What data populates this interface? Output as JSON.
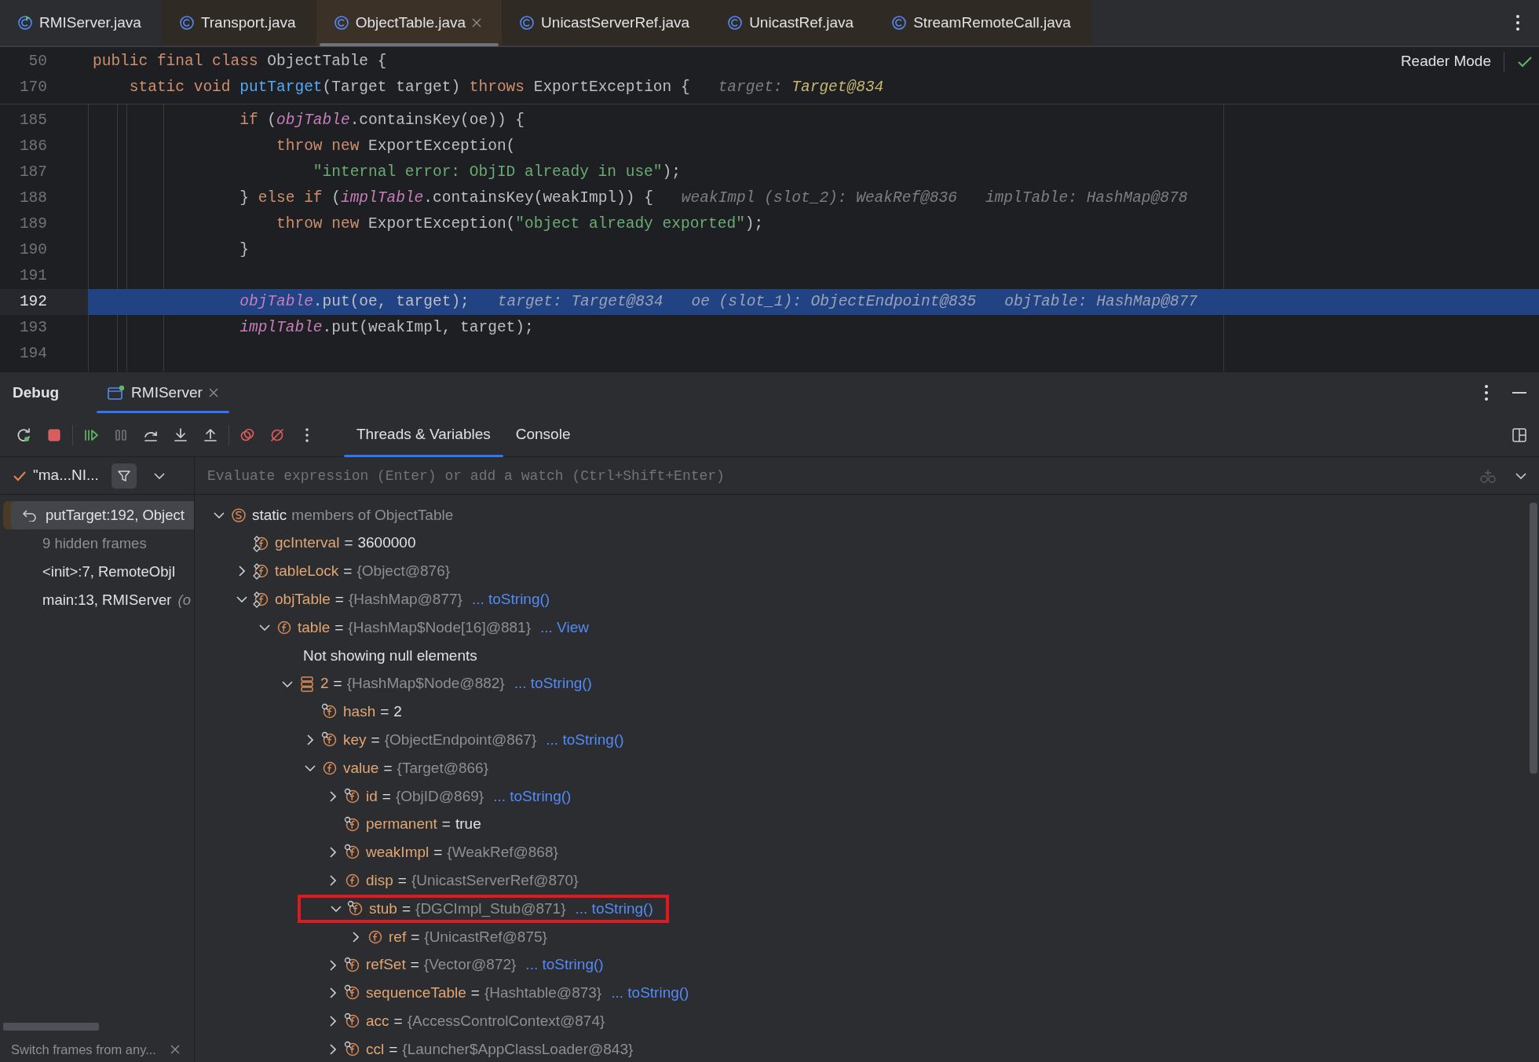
{
  "editor_tabs": [
    {
      "label": "RMIServer.java",
      "kind": "runnable",
      "color": "#2b2d30",
      "selected": false
    },
    {
      "label": "Transport.java",
      "kind": "class",
      "color": "#2f2a23",
      "selected": false
    },
    {
      "label": "ObjectTable.java",
      "kind": "class",
      "color": "#3b3127",
      "selected": true
    },
    {
      "label": "UnicastServerRef.java",
      "kind": "class",
      "color": "#2f2a23",
      "selected": false
    },
    {
      "label": "UnicastRef.java",
      "kind": "class",
      "color": "#2f2a23",
      "selected": false
    },
    {
      "label": "StreamRemoteCall.java",
      "kind": "class",
      "color": "#2f2a23",
      "selected": false
    }
  ],
  "reader_mode": "Reader Mode",
  "sticky_lines": [
    {
      "number": "50",
      "tokens": [
        {
          "kind": "kw",
          "text": "public final class "
        },
        {
          "kind": "plain",
          "text": "ObjectTable {"
        }
      ]
    },
    {
      "number": "170",
      "tokens": [
        {
          "kind": "kw",
          "text": "    static void "
        },
        {
          "kind": "fn",
          "text": "putTarget"
        },
        {
          "kind": "plain",
          "text": "(Target target) "
        },
        {
          "kind": "kw",
          "text": "throws "
        },
        {
          "kind": "plain",
          "text": "ExportException {"
        },
        {
          "kind": "hint",
          "text": "target: "
        },
        {
          "kind": "hintval",
          "text": "Target@834"
        }
      ]
    }
  ],
  "code_lines": [
    {
      "number": "185",
      "current": false,
      "tokens": [
        {
          "kind": "kw",
          "text": "                if "
        },
        {
          "kind": "plain",
          "text": "("
        },
        {
          "kind": "field",
          "text": "objTable"
        },
        {
          "kind": "plain",
          "text": ".containsKey(oe)) {"
        }
      ]
    },
    {
      "number": "186",
      "current": false,
      "tokens": [
        {
          "kind": "kw",
          "text": "                    throw new "
        },
        {
          "kind": "plain",
          "text": "ExportException("
        }
      ]
    },
    {
      "number": "187",
      "current": false,
      "tokens": [
        {
          "kind": "str",
          "text": "                        \"internal error: ObjID already in use\""
        },
        {
          "kind": "plain",
          "text": ");"
        }
      ]
    },
    {
      "number": "188",
      "current": false,
      "tokens": [
        {
          "kind": "plain",
          "text": "                } "
        },
        {
          "kind": "kw",
          "text": "else if "
        },
        {
          "kind": "plain",
          "text": "("
        },
        {
          "kind": "field",
          "text": "implTable"
        },
        {
          "kind": "plain",
          "text": ".containsKey(weakImpl)) {"
        },
        {
          "kind": "hint",
          "text": "weakImpl (slot_2): WeakRef@836"
        },
        {
          "kind": "hint",
          "text": "implTable: HashMap@878"
        }
      ]
    },
    {
      "number": "189",
      "current": false,
      "tokens": [
        {
          "kind": "kw",
          "text": "                    throw new "
        },
        {
          "kind": "plain",
          "text": "ExportException("
        },
        {
          "kind": "str",
          "text": "\"object already exported\""
        },
        {
          "kind": "plain",
          "text": ");"
        }
      ]
    },
    {
      "number": "190",
      "current": false,
      "tokens": [
        {
          "kind": "plain",
          "text": "                }"
        }
      ]
    },
    {
      "number": "191",
      "current": false
    },
    {
      "number": "192",
      "current": true,
      "tokens": [
        {
          "kind": "field",
          "text": "                objTable"
        },
        {
          "kind": "plain",
          "text": ".put(oe, target);"
        },
        {
          "kind": "hint",
          "text": "target: Target@834"
        },
        {
          "kind": "hint",
          "text": "oe (slot_1): ObjectEndpoint@835"
        },
        {
          "kind": "hint",
          "text": "objTable: HashMap@877"
        }
      ]
    },
    {
      "number": "193",
      "current": false,
      "tokens": [
        {
          "kind": "field",
          "text": "                implTable"
        },
        {
          "kind": "plain",
          "text": ".put(weakImpl, target);"
        }
      ]
    },
    {
      "number": "194",
      "current": false
    }
  ],
  "debug": {
    "title": "Debug",
    "sessions": [
      {
        "label": "RMIServer",
        "selected": true
      }
    ],
    "tool_tabs": [
      {
        "label": "Threads & Variables",
        "selected": true
      },
      {
        "label": "Console",
        "selected": false
      }
    ],
    "thread": "\"ma...NI...",
    "evaluate": {
      "placeholder": "Evaluate expression (Enter) or add a watch (Ctrl+Shift+Enter)"
    },
    "frames": [
      {
        "kind": "frame",
        "label": "putTarget:192, Object",
        "selected": true
      },
      {
        "kind": "hidden",
        "label": "9 hidden frames",
        "selected": false
      },
      {
        "kind": "frame",
        "label": "<init>:7, RemoteObjI",
        "selected": false
      },
      {
        "kind": "frame",
        "label": "main:13, RMIServer",
        "suffix": "(o",
        "selected": false
      }
    ],
    "frames_hint": "Switch frames from any...",
    "variables": [
      {
        "kind": "group",
        "name": "static",
        "value": "members of ObjectTable",
        "expanded": true,
        "children": [
          {
            "kind": "static-field",
            "name": "gcInterval",
            "sep": "=",
            "value": "3600000",
            "object": false
          },
          {
            "kind": "static-field",
            "name": "tableLock",
            "sep": "=",
            "value": "{Object@876}",
            "object": true,
            "expanded": false
          },
          {
            "kind": "static-field",
            "name": "objTable",
            "sep": "=",
            "value": "{HashMap@877}",
            "object": true,
            "link": "... toString()",
            "expanded": true,
            "children": [
              {
                "kind": "field",
                "name": "table",
                "sep": "=",
                "value": "{HashMap$Node[16]@881}",
                "object": true,
                "link": "... View",
                "expanded": true,
                "children": [
                  {
                    "kind": "message",
                    "name": "Not showing null elements"
                  },
                  {
                    "kind": "array-item",
                    "name": "2",
                    "sep": "=",
                    "value": "{HashMap$Node@882}",
                    "object": true,
                    "link": "... toString()",
                    "expanded": true,
                    "children": [
                      {
                        "kind": "final-field",
                        "name": "hash",
                        "sep": "=",
                        "value": "2",
                        "object": false
                      },
                      {
                        "kind": "final-field",
                        "name": "key",
                        "sep": "=",
                        "value": "{ObjectEndpoint@867}",
                        "object": true,
                        "link": "... toString()",
                        "expanded": false
                      },
                      {
                        "kind": "field",
                        "name": "value",
                        "sep": "=",
                        "value": "{Target@866}",
                        "object": true,
                        "expanded": true,
                        "children": [
                          {
                            "kind": "final-field",
                            "name": "id",
                            "sep": "=",
                            "value": "{ObjID@869}",
                            "object": true,
                            "link": "... toString()",
                            "expanded": false
                          },
                          {
                            "kind": "final-field",
                            "name": "permanent",
                            "sep": "=",
                            "value": "true",
                            "object": false
                          },
                          {
                            "kind": "final-field",
                            "name": "weakImpl",
                            "sep": "=",
                            "value": "{WeakRef@868}",
                            "object": true,
                            "expanded": false
                          },
                          {
                            "kind": "field",
                            "name": "disp",
                            "sep": "=",
                            "value": "{UnicastServerRef@870}",
                            "object": true,
                            "expanded": false
                          },
                          {
                            "kind": "final-field",
                            "name": "stub",
                            "sep": "=",
                            "value": "{DGCImpl_Stub@871}",
                            "object": true,
                            "link": "... toString()",
                            "expanded": true,
                            "highlighted": true,
                            "children": [
                              {
                                "kind": "field",
                                "name": "ref",
                                "sep": "=",
                                "value": "{UnicastRef@875}",
                                "object": true,
                                "expanded": false
                              }
                            ]
                          },
                          {
                            "kind": "final-field",
                            "name": "refSet",
                            "sep": "=",
                            "value": "{Vector@872}",
                            "object": true,
                            "link": "... toString()",
                            "expanded": false
                          },
                          {
                            "kind": "final-field",
                            "name": "sequenceTable",
                            "sep": "=",
                            "value": "{Hashtable@873}",
                            "object": true,
                            "link": "... toString()",
                            "expanded": false
                          },
                          {
                            "kind": "final-field",
                            "name": "acc",
                            "sep": "=",
                            "value": "{AccessControlContext@874}",
                            "object": true,
                            "expanded": false
                          },
                          {
                            "kind": "final-field",
                            "name": "ccl",
                            "sep": "=",
                            "value": "{Launcher$AppClassLoader@843}",
                            "object": true,
                            "expanded": false
                          }
                        ]
                      }
                    ]
                  }
                ]
              }
            ]
          }
        ]
      }
    ]
  }
}
